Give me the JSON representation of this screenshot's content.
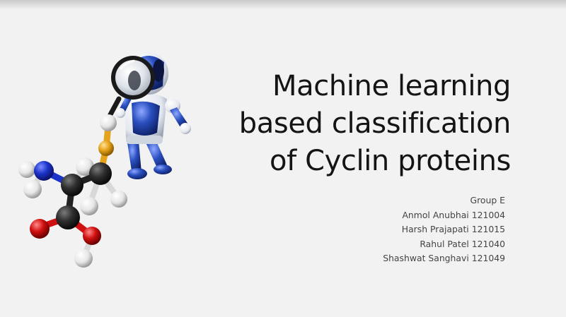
{
  "slide": {
    "title_lines": [
      "Machine learning",
      "based classification",
      "of Cyclin proteins"
    ],
    "group": "Group E",
    "members": [
      "Anmol Anubhai 121004",
      "Harsh Prajapati 121015",
      "Rahul Patel 121040",
      "Shashwat Sanghavi 121049"
    ]
  },
  "colors": {
    "background": "#f2f2f2",
    "title_text": "#141414",
    "info_text": "#444444",
    "robot_blue": "#1f3f9e",
    "nitrogen": "#1c33c8",
    "oxygen": "#d01010",
    "sulfur": "#e6a21a",
    "carbon": "#2a2a2a",
    "hydrogen": "#f2f2f2"
  },
  "icons": [
    "robot-icon",
    "magnifying-glass-icon",
    "molecule-icon"
  ]
}
